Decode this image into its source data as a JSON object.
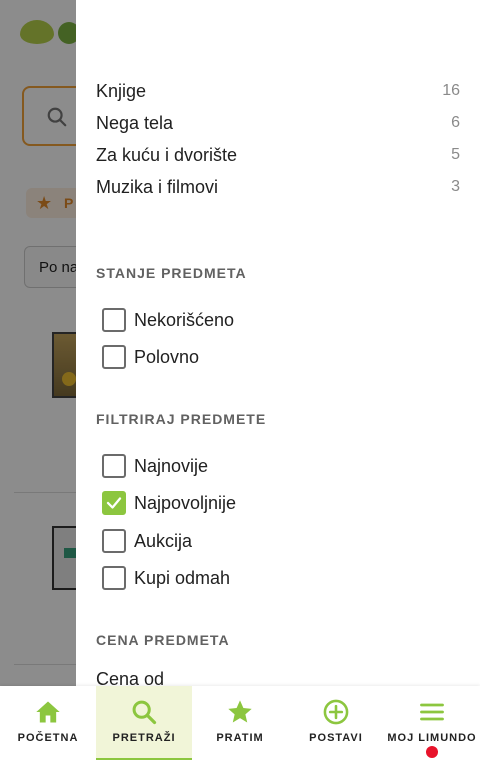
{
  "background": {
    "promo_initial": "P",
    "sort_label": "Po na"
  },
  "categories": [
    {
      "name": "Knjige",
      "count": "16"
    },
    {
      "name": "Nega tela",
      "count": "6"
    },
    {
      "name": "Za kuću i dvorište",
      "count": "5"
    },
    {
      "name": "Muzika i filmovi",
      "count": "3"
    }
  ],
  "condition": {
    "title": "STANJE PREDMETA",
    "options": [
      {
        "label": "Nekorišćeno",
        "checked": false
      },
      {
        "label": "Polovno",
        "checked": false
      }
    ]
  },
  "filter": {
    "title": "FILTRIRAJ PREDMETE",
    "options": [
      {
        "label": "Najnovije",
        "checked": false
      },
      {
        "label": "Najpovoljnije",
        "checked": true
      },
      {
        "label": "Aukcija",
        "checked": false
      },
      {
        "label": "Kupi odmah",
        "checked": false
      }
    ]
  },
  "price": {
    "title": "CENA PREDMETA",
    "from_label": "Cena od"
  },
  "bottom_nav": [
    {
      "label": "POČETNA",
      "icon": "home-icon",
      "active": false
    },
    {
      "label": "PRETRAŽI",
      "icon": "search-icon",
      "active": true
    },
    {
      "label": "PRATIM",
      "icon": "star-icon",
      "active": false
    },
    {
      "label": "POSTAVI",
      "icon": "plus-circle-icon",
      "active": false
    },
    {
      "label": "MOJ LIMUNDO",
      "icon": "menu-icon",
      "active": false,
      "notification_dot": true
    }
  ],
  "colors": {
    "accent": "#8cc63f",
    "active_tab_bg": "#f1f5d8",
    "notification": "#e8132b",
    "orange": "#f2a23a"
  }
}
